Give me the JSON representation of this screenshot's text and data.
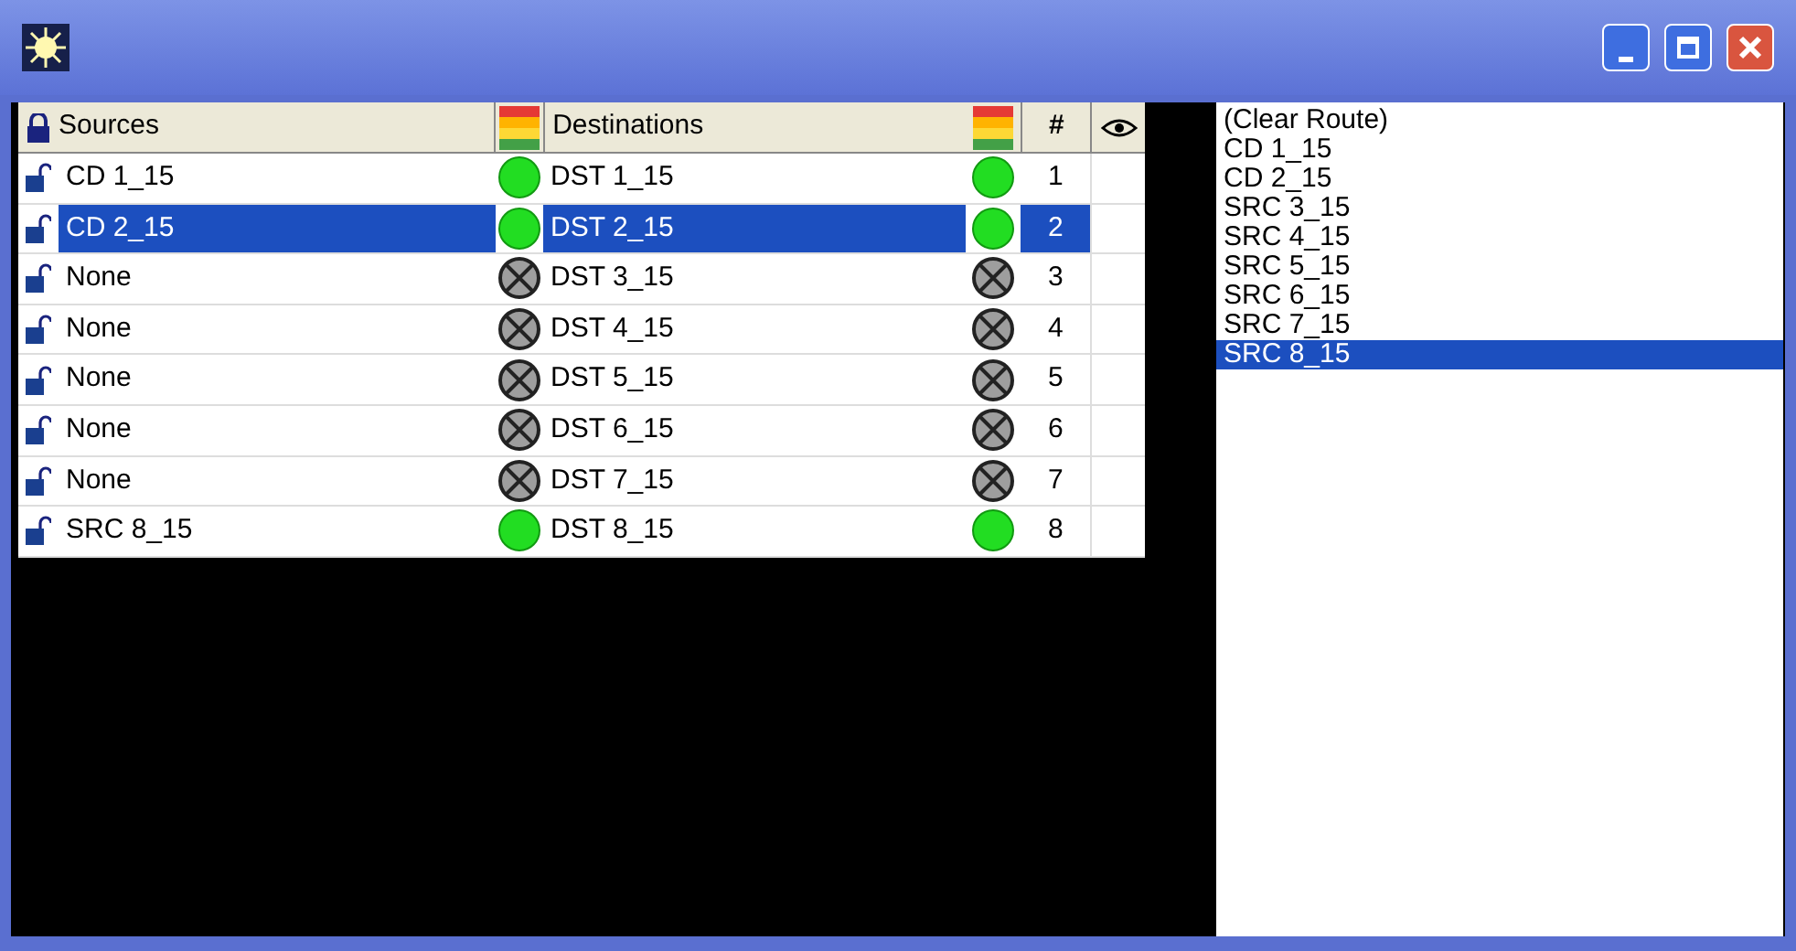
{
  "table": {
    "columns": [
      "Sources",
      "Destinations",
      "#"
    ],
    "rows": [
      {
        "source": "CD 1_15",
        "locked": false,
        "source_connected": true,
        "destination": "DST 1_15",
        "destination_connected": true,
        "number": "1",
        "selected": false
      },
      {
        "source": "CD 2_15",
        "locked": false,
        "source_connected": true,
        "destination": "DST 2_15",
        "destination_connected": true,
        "number": "2",
        "selected": true
      },
      {
        "source": "None",
        "locked": false,
        "source_connected": false,
        "destination": "DST 3_15",
        "destination_connected": false,
        "number": "3",
        "selected": false
      },
      {
        "source": "None",
        "locked": false,
        "source_connected": false,
        "destination": "DST 4_15",
        "destination_connected": false,
        "number": "4",
        "selected": false
      },
      {
        "source": "None",
        "locked": false,
        "source_connected": false,
        "destination": "DST 5_15",
        "destination_connected": false,
        "number": "5",
        "selected": false
      },
      {
        "source": "None",
        "locked": false,
        "source_connected": false,
        "destination": "DST 6_15",
        "destination_connected": false,
        "number": "6",
        "selected": false
      },
      {
        "source": "None",
        "locked": false,
        "source_connected": false,
        "destination": "DST 7_15",
        "destination_connected": false,
        "number": "7",
        "selected": false
      },
      {
        "source": "SRC 8_15",
        "locked": false,
        "source_connected": true,
        "destination": "DST 8_15",
        "destination_connected": true,
        "number": "8",
        "selected": false
      }
    ]
  },
  "source_list": [
    {
      "label": "(Clear Route)",
      "selected": false
    },
    {
      "label": "CD 1_15",
      "selected": false
    },
    {
      "label": "CD 2_15",
      "selected": false
    },
    {
      "label": "SRC 3_15",
      "selected": false
    },
    {
      "label": "SRC 4_15",
      "selected": false
    },
    {
      "label": "SRC 5_15",
      "selected": false
    },
    {
      "label": "SRC 6_15",
      "selected": false
    },
    {
      "label": "SRC 7_15",
      "selected": false
    },
    {
      "label": "SRC 8_15",
      "selected": true
    }
  ]
}
